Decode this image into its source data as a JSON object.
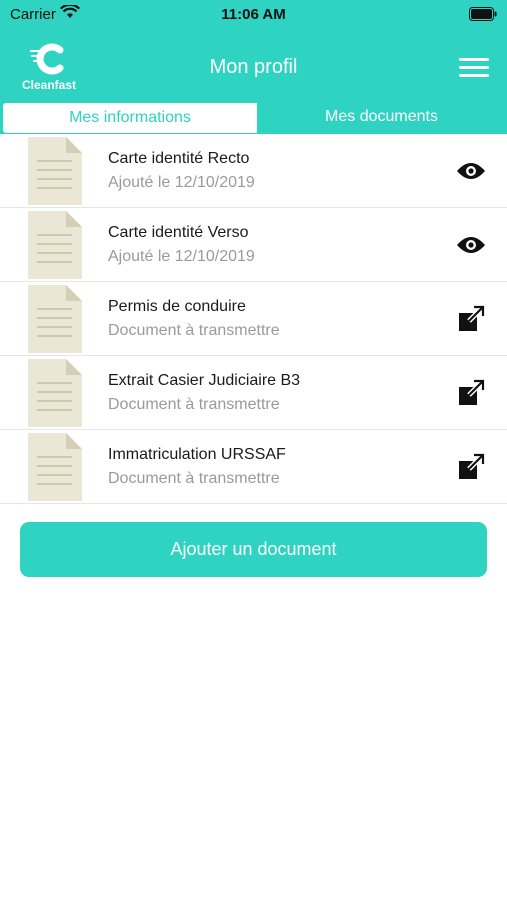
{
  "status": {
    "carrier": "Carrier",
    "time": "11:06 AM"
  },
  "header": {
    "logo_text": "Cleanfast",
    "title": "Mon profil",
    "menu_icon": "hamburger-menu-icon"
  },
  "tabs": [
    {
      "label": "Mes informations"
    },
    {
      "label": "Mes documents"
    }
  ],
  "documents": [
    {
      "title": "Carte identité Recto",
      "subtitle": "Ajouté le 12/10/2019",
      "action_icon": "eye-icon"
    },
    {
      "title": "Carte identité Verso",
      "subtitle": "Ajouté le 12/10/2019",
      "action_icon": "eye-icon"
    },
    {
      "title": "Permis de conduire",
      "subtitle": "Document à transmettre",
      "action_icon": "external-link-icon"
    },
    {
      "title": "Extrait Casier Judiciaire B3",
      "subtitle": "Document à transmettre",
      "action_icon": "external-link-icon"
    },
    {
      "title": "Immatriculation URSSAF",
      "subtitle": "Document à transmettre",
      "action_icon": "external-link-icon"
    }
  ],
  "add_button": {
    "label": "Ajouter un document"
  },
  "colors": {
    "accent": "#2ed3c2",
    "muted_text": "#9a9a9a",
    "doc_icon": "#ebe7d6"
  }
}
